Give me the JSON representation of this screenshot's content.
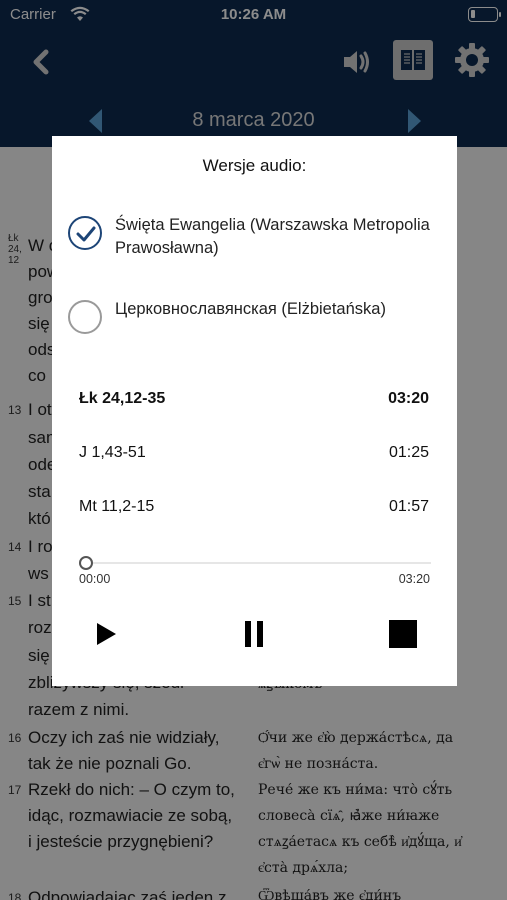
{
  "status_bar": {
    "carrier": "Carrier",
    "time": "10:26 AM"
  },
  "date_bar": {
    "date": "8 marca 2020"
  },
  "reading": {
    "polish": [
      {
        "num": "Łk 24, 12",
        "text": "W o"
      },
      {
        "num": "",
        "text": "pow"
      },
      {
        "num": "",
        "text": "gro"
      },
      {
        "num": "",
        "text": "się"
      },
      {
        "num": "",
        "text": "ods"
      },
      {
        "num": "",
        "text": "co"
      },
      {
        "num": "13",
        "text": "I ot"
      },
      {
        "num": "",
        "text": "san"
      },
      {
        "num": "",
        "text": "ode"
      },
      {
        "num": "",
        "text": "sta"
      },
      {
        "num": "",
        "text": "któ"
      },
      {
        "num": "14",
        "text": "I ro"
      },
      {
        "num": "",
        "text": "ws"
      },
      {
        "num": "15",
        "text": "I st"
      },
      {
        "num": "",
        "text": "roz"
      },
      {
        "num": "",
        "text": "się"
      },
      {
        "num": "",
        "text": "zbliżywszy się, szedł"
      },
      {
        "num": "",
        "text": "razem z nimi."
      },
      {
        "num": "16",
        "text": "Oczy ich zaś nie widziały,"
      },
      {
        "num": "",
        "text": "tak że nie poznali Go."
      },
      {
        "num": "17",
        "text": "Rzekł do nich: – O czym to,"
      },
      {
        "num": "",
        "text": "idąc, rozmawiacie ze sobą,"
      },
      {
        "num": "",
        "text": "i jesteście przygnębieni?"
      },
      {
        "num": "18",
        "text": "Odpowiadając zaś jeden z"
      }
    ],
    "slavonic": [
      {
        "text": "ѧ҆ꙁꙑкомъ"
      },
      {
        "text": "Ѻ҆́чи же є҆ю̀ держа́стѣсѧ, да"
      },
      {
        "text": "є҆гѡ̀ не позна́ста."
      },
      {
        "text": "Рече́ же къ ни́ма: что̀ сꙋ́ть"
      },
      {
        "text": "словеса̀ сїѧ̑, ꙗ҆̀же ни́ꙗже"
      },
      {
        "text": "стѧꙁа́етасѧ къ себѣ̀ и҆дꙋ́ща, и҆"
      },
      {
        "text": "є҆ста̀ дрѧ́хла;"
      },
      {
        "text": "Ѿвѣща́въ же є҆ди́нъ"
      }
    ]
  },
  "dialog": {
    "title": "Wersje audio:",
    "options": [
      {
        "label": "Święta Ewangelia (Warszawska Metropolia Prawosławna)",
        "selected": true
      },
      {
        "label": "Церковнославянская (Elżbietańska)",
        "selected": false
      }
    ],
    "tracks": [
      {
        "name": "Łk 24,12-35",
        "duration": "03:20",
        "active": true
      },
      {
        "name": "J 1,43-51",
        "duration": "01:25",
        "active": false
      },
      {
        "name": "Mt 11,2-15",
        "duration": "01:57",
        "active": false
      }
    ],
    "progress": {
      "position": 0,
      "start": "00:00",
      "end": "03:20"
    }
  },
  "colors": {
    "nav": "#0d2b4f",
    "accent": "#1d4577",
    "overlay": "rgba(0,0,0,0.45)"
  },
  "icons": [
    "wifi-icon",
    "battery-icon",
    "back-icon",
    "speaker-icon",
    "book-icon",
    "gear-icon",
    "prev-day-icon",
    "next-day-icon",
    "check-icon",
    "play-icon",
    "pause-icon",
    "stop-icon"
  ]
}
